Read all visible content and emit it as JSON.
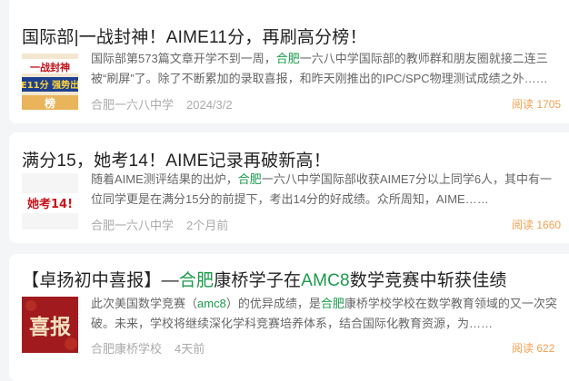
{
  "articles": [
    {
      "title": "国际部|一战封神！AIME11分，再刷高分榜！",
      "summary_before": "国际部第573篇文章开学不到一周，",
      "summary_highlight": "合肥",
      "summary_after": "一六八中学国际部的教师群和朋友圈就接二连三被“刷屏”了。除了不断累加的录取喜报，和昨天刚推出的IPC/SPC物理测试成绩之外……",
      "source": "合肥一六八中学",
      "date": "2024/3/2",
      "reads_label": "阅读",
      "reads": "1705",
      "thumb": {
        "line1": "一战封神",
        "line2": "E11分 强势出",
        "line3": "榜"
      }
    },
    {
      "title": "满分15，她考14！AIME记录再破新高！",
      "summary_before": "随着AIME测评结果的出炉，",
      "summary_highlight": "合肥",
      "summary_after": "一六八中学国际部收获AIME7分以上同学6人，其中有一位同学更是在满分15分的前提下，考出14分的好成绩。众所周知，AIME……",
      "source": "合肥一六八中学",
      "date": "2个月前",
      "reads_label": "阅读",
      "reads": "1660",
      "thumb": {
        "text": "她考14!"
      }
    },
    {
      "title_p1": "【卓扬初中喜报】—",
      "title_h1": "合肥",
      "title_p2": "康桥学子在",
      "title_h2": "AMC8",
      "title_p3": "数学竞赛中斩获佳绩",
      "summary_p1": "此次美国数学竞赛（",
      "summary_h1": "amc8",
      "summary_p2": "）的优异成绩，是",
      "summary_h2": "合肥",
      "summary_p3": "康桥学校学校在数学教育领域的又一次突破。未来，学校将继续深化学科竞赛培养体系，结合国际化教育资源，为……",
      "source": "合肥康桥学校",
      "date": "4天前",
      "reads_label": "阅读",
      "reads": "622",
      "thumb": {
        "text": "喜报"
      }
    }
  ],
  "colors": {
    "highlight": "#1a9b4b",
    "reads": "#f0a050",
    "title": "#222222",
    "summary": "#666666",
    "meta": "#aaaaaa"
  }
}
